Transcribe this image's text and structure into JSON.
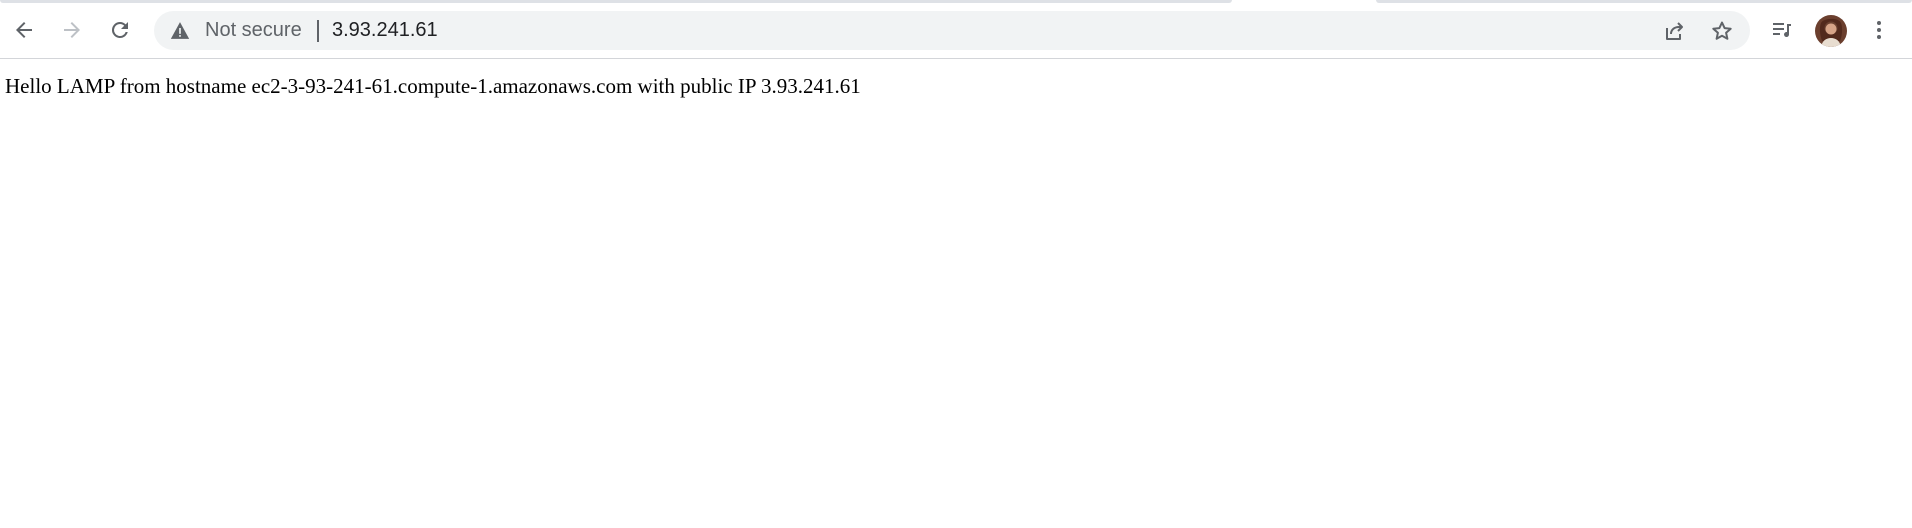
{
  "browser": {
    "security_label": "Not secure",
    "address": "3.93.241.61",
    "icons": {
      "back": "arrow-left-icon",
      "forward": "arrow-right-icon",
      "reload": "reload-icon",
      "security": "warning-triangle-icon",
      "share": "share-icon",
      "bookmark": "star-icon",
      "media": "media-queue-icon",
      "profile": "avatar",
      "menu": "three-dots-vertical-icon"
    },
    "colors": {
      "toolbar_icon": "#5f6368",
      "forward_disabled": "#bdc1c6",
      "omnibox_bg": "#f1f3f4"
    }
  },
  "page": {
    "body_text": "Hello LAMP from hostname ec2-3-93-241-61.compute-1.amazonaws.com with public IP 3.93.241.61"
  }
}
